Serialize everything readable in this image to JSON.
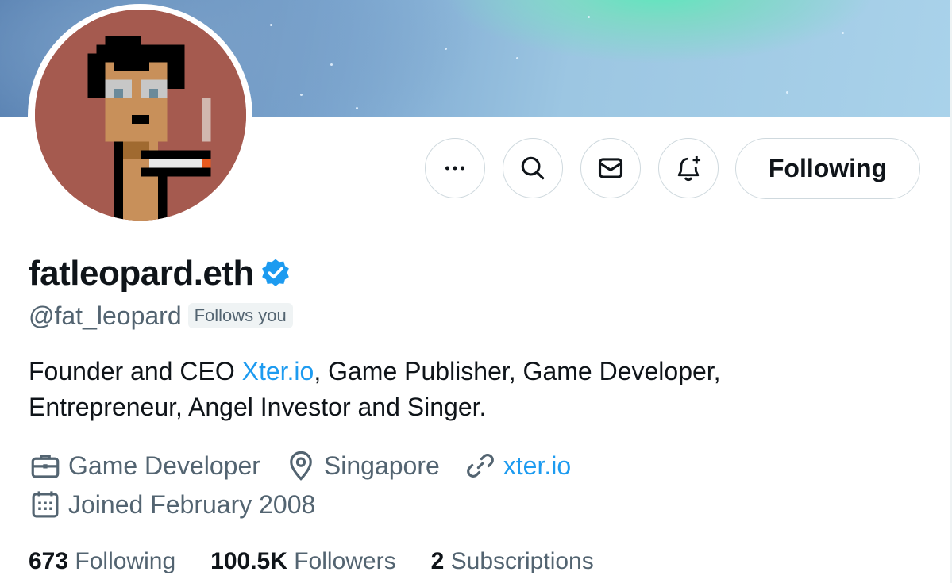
{
  "profile": {
    "display_name": "fatleopard.eth",
    "handle": "@fat_leopard",
    "follows_you_badge": "Follows you",
    "verified_icon": "verified-badge-icon",
    "bio_prefix": "Founder and CEO ",
    "bio_link": "Xter.io",
    "bio_line1_rest": ", Game Publisher, Game Developer,",
    "bio_line2": "Entrepreneur, Angel Investor and Singer."
  },
  "actions": {
    "more_icon": "more-icon",
    "search_icon": "search-icon",
    "message_icon": "message-icon",
    "notify_icon": "bell-plus-icon",
    "follow_label": "Following"
  },
  "meta": {
    "category": "Game Developer",
    "location": "Singapore",
    "website": "xter.io",
    "joined": "Joined February 2008"
  },
  "stats": {
    "following_count": "673",
    "following_label": "Following",
    "followers_count": "100.5K",
    "followers_label": "Followers",
    "subscriptions_count": "2",
    "subscriptions_label": "Subscriptions"
  },
  "colors": {
    "accent": "#1d9bf0",
    "text": "#0f1419",
    "secondary_text": "#536471",
    "border": "#cfd9de",
    "avatar_bg": "#a55a4f"
  }
}
